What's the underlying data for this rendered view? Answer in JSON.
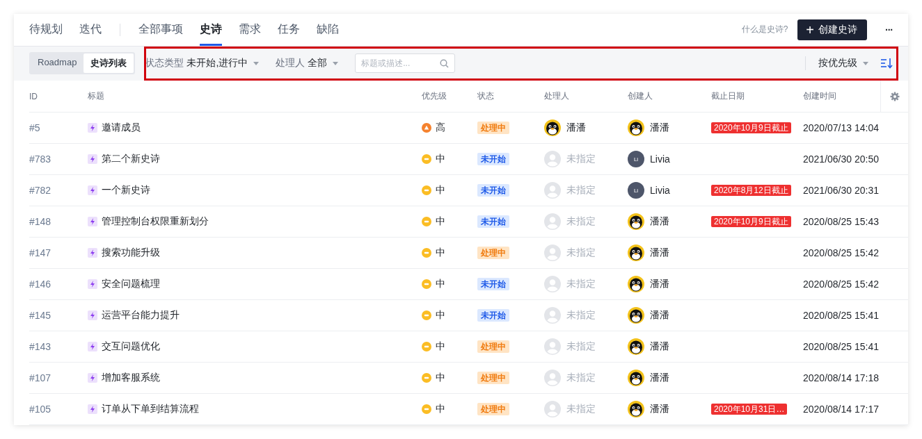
{
  "view_tabs": [
    {
      "label": "待规划",
      "selected": false
    },
    {
      "label": "迭代",
      "selected": false
    }
  ],
  "item_tabs": [
    {
      "label": "全部事项",
      "selected": false
    },
    {
      "label": "史诗",
      "selected": true
    },
    {
      "label": "需求",
      "selected": false
    },
    {
      "label": "任务",
      "selected": false
    },
    {
      "label": "缺陷",
      "selected": false
    }
  ],
  "help_link": "什么是史诗?",
  "create_button": {
    "icon": "+",
    "label": "创建史诗"
  },
  "more_button": "···",
  "view_switch": [
    {
      "label": "Roadmap",
      "selected": false
    },
    {
      "label": "史诗列表",
      "selected": true
    }
  ],
  "filters": [
    {
      "label": "状态类型",
      "value": "未开始,进行中"
    },
    {
      "label": "处理人",
      "value": "全部"
    }
  ],
  "search": {
    "placeholder": "标题或描述..."
  },
  "sort": {
    "label": "按优先级"
  },
  "table": {
    "columns": [
      "ID",
      "标题",
      "优先级",
      "状态",
      "处理人",
      "创建人",
      "截止日期",
      "创建时间"
    ],
    "rows": [
      {
        "id": "#5",
        "title": "邀请成员",
        "priority": {
          "label": "高",
          "kind": "high"
        },
        "status": {
          "label": "处理中",
          "kind": "in_progress"
        },
        "assignee": {
          "name": "潘潘",
          "avatar": {
            "kind": "penguin"
          },
          "assigned": true
        },
        "creator": {
          "name": "潘潘",
          "avatar": {
            "kind": "penguin"
          }
        },
        "deadline": "2020年10月9日截止",
        "created": "2020/07/13 14:04"
      },
      {
        "id": "#783",
        "title": "第二个新史诗",
        "priority": {
          "label": "中",
          "kind": "medium"
        },
        "status": {
          "label": "未开始",
          "kind": "not_started"
        },
        "assignee": {
          "name": "未指定",
          "avatar": {
            "kind": "placeholder"
          },
          "assigned": false
        },
        "creator": {
          "name": "Livia",
          "avatar": {
            "kind": "initials",
            "initials": "Li"
          }
        },
        "created": "2021/06/30 20:50"
      },
      {
        "id": "#782",
        "title": "一个新史诗",
        "priority": {
          "label": "中",
          "kind": "medium"
        },
        "status": {
          "label": "未开始",
          "kind": "not_started"
        },
        "assignee": {
          "name": "未指定",
          "avatar": {
            "kind": "placeholder"
          },
          "assigned": false
        },
        "creator": {
          "name": "Livia",
          "avatar": {
            "kind": "initials",
            "initials": "Li"
          }
        },
        "deadline": "2020年8月12日截止",
        "created": "2021/06/30 20:31"
      },
      {
        "id": "#148",
        "title": "管理控制台权限重新划分",
        "priority": {
          "label": "中",
          "kind": "medium"
        },
        "status": {
          "label": "未开始",
          "kind": "not_started"
        },
        "assignee": {
          "name": "未指定",
          "avatar": {
            "kind": "placeholder"
          },
          "assigned": false
        },
        "creator": {
          "name": "潘潘",
          "avatar": {
            "kind": "penguin"
          }
        },
        "deadline": "2020年10月9日截止",
        "created": "2020/08/25 15:43"
      },
      {
        "id": "#147",
        "title": "搜索功能升级",
        "priority": {
          "label": "中",
          "kind": "medium"
        },
        "status": {
          "label": "处理中",
          "kind": "in_progress"
        },
        "assignee": {
          "name": "未指定",
          "avatar": {
            "kind": "placeholder"
          },
          "assigned": false
        },
        "creator": {
          "name": "潘潘",
          "avatar": {
            "kind": "penguin"
          }
        },
        "created": "2020/08/25 15:42"
      },
      {
        "id": "#146",
        "title": "安全问题梳理",
        "priority": {
          "label": "中",
          "kind": "medium"
        },
        "status": {
          "label": "未开始",
          "kind": "not_started"
        },
        "assignee": {
          "name": "未指定",
          "avatar": {
            "kind": "placeholder"
          },
          "assigned": false
        },
        "creator": {
          "name": "潘潘",
          "avatar": {
            "kind": "penguin"
          }
        },
        "created": "2020/08/25 15:42"
      },
      {
        "id": "#145",
        "title": "运营平台能力提升",
        "priority": {
          "label": "中",
          "kind": "medium"
        },
        "status": {
          "label": "未开始",
          "kind": "not_started"
        },
        "assignee": {
          "name": "未指定",
          "avatar": {
            "kind": "placeholder"
          },
          "assigned": false
        },
        "creator": {
          "name": "潘潘",
          "avatar": {
            "kind": "penguin"
          }
        },
        "created": "2020/08/25 15:41"
      },
      {
        "id": "#143",
        "title": "交互问题优化",
        "priority": {
          "label": "中",
          "kind": "medium"
        },
        "status": {
          "label": "处理中",
          "kind": "in_progress"
        },
        "assignee": {
          "name": "未指定",
          "avatar": {
            "kind": "placeholder"
          },
          "assigned": false
        },
        "creator": {
          "name": "潘潘",
          "avatar": {
            "kind": "penguin"
          }
        },
        "created": "2020/08/25 15:41"
      },
      {
        "id": "#107",
        "title": "增加客服系统",
        "priority": {
          "label": "中",
          "kind": "medium"
        },
        "status": {
          "label": "处理中",
          "kind": "in_progress"
        },
        "assignee": {
          "name": "未指定",
          "avatar": {
            "kind": "placeholder"
          },
          "assigned": false
        },
        "creator": {
          "name": "潘潘",
          "avatar": {
            "kind": "penguin"
          }
        },
        "created": "2020/08/14 17:18"
      },
      {
        "id": "#105",
        "title": "订单从下单到结算流程",
        "priority": {
          "label": "中",
          "kind": "medium"
        },
        "status": {
          "label": "处理中",
          "kind": "in_progress"
        },
        "assignee": {
          "name": "未指定",
          "avatar": {
            "kind": "placeholder"
          },
          "assigned": false
        },
        "creator": {
          "name": "潘潘",
          "avatar": {
            "kind": "penguin"
          }
        },
        "deadline": "2020年10月31日…",
        "created": "2020/08/14 17:17"
      }
    ]
  }
}
